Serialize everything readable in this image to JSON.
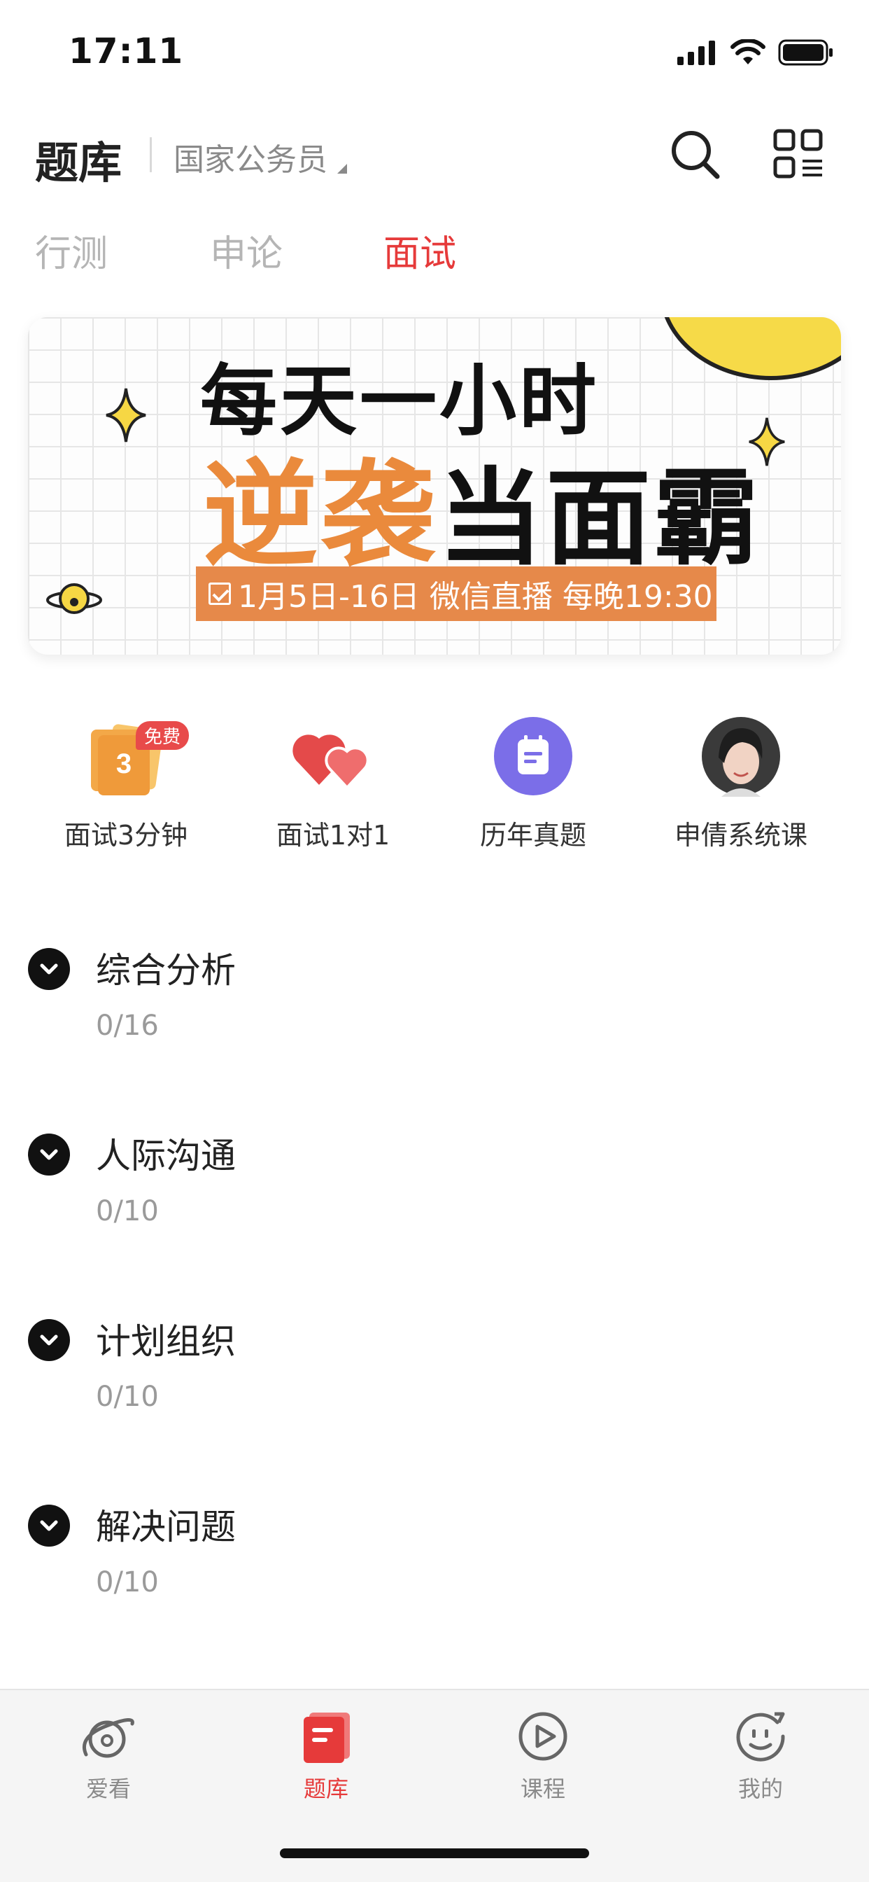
{
  "status": {
    "time": "17:11"
  },
  "header": {
    "title": "题库",
    "exam_type": "国家公务员"
  },
  "tabs": [
    {
      "label": "行测",
      "active": false
    },
    {
      "label": "申论",
      "active": false
    },
    {
      "label": "面试",
      "active": true
    }
  ],
  "banner": {
    "line1": "每天一小时",
    "highlight": "逆袭",
    "rest": "当面霸",
    "tag": "1月5日-16日 微信直播 每晚19:30"
  },
  "quick_actions": [
    {
      "label": "面试3分钟",
      "icon": "cards-icon",
      "badge": "免费",
      "number": "3"
    },
    {
      "label": "面试1对1",
      "icon": "hearts-icon"
    },
    {
      "label": "历年真题",
      "icon": "calendar-icon"
    },
    {
      "label": "申倩系统课",
      "icon": "teacher-avatar"
    }
  ],
  "categories": [
    {
      "title": "综合分析",
      "progress": "0/16"
    },
    {
      "title": "人际沟通",
      "progress": "0/10"
    },
    {
      "title": "计划组织",
      "progress": "0/10"
    },
    {
      "title": "解决问题",
      "progress": "0/10"
    }
  ],
  "bottom_nav": [
    {
      "label": "爱看",
      "icon": "planet-icon",
      "active": false
    },
    {
      "label": "题库",
      "icon": "book-icon",
      "active": true
    },
    {
      "label": "课程",
      "icon": "play-icon",
      "active": false
    },
    {
      "label": "我的",
      "icon": "face-icon",
      "active": false
    }
  ],
  "colors": {
    "accent": "#e63a3a",
    "banner_orange": "#ea8a3c",
    "banner_tag": "#e6894a",
    "corner_yellow": "#f6da48",
    "calendar_purple": "#7b6ee8"
  }
}
